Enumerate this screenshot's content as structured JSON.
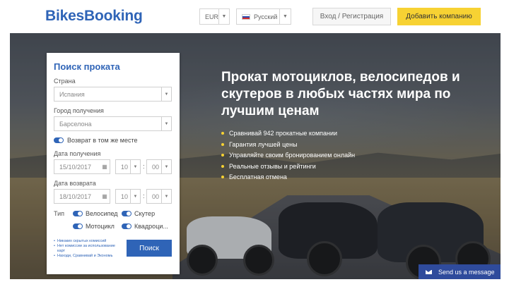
{
  "header": {
    "logo": "BikesBooking",
    "currency": "EUR",
    "language": "Русский",
    "login_label": "Вход / Регистрация",
    "add_company_label": "Добавить компанию"
  },
  "hero": {
    "headline": "Прокат мотоциклов, велосипедов и скутеров в любых частях мира по лучшим ценам",
    "bullets": [
      "Сравнивай 942 прокатные компании",
      "Гарантия лучшей цены",
      "Управляйте своим бронированием онлайн",
      "Реальные отзывы и рейтинги",
      "Бесплатная отмена"
    ]
  },
  "search": {
    "title": "Поиск проката",
    "country_label": "Страна",
    "country_value": "Испания",
    "city_label": "Город получения",
    "city_value": "Барселона",
    "same_place_label": "Возврат в том же месте",
    "pickup_label": "Дата получения",
    "pickup_date": "15/10/2017",
    "pickup_hour": "10",
    "pickup_min": "00",
    "return_label": "Дата возврата",
    "return_date": "18/10/2017",
    "return_hour": "10",
    "return_min": "00",
    "type_label": "Тип",
    "types": [
      "Велосипед",
      "Скутер",
      "Мотоцикл",
      "Квадроци..."
    ],
    "notes": [
      "Никаких скрытых комиссий",
      "Нет комиссии за использование карт",
      "Находи, Сравнивай и Экономь"
    ],
    "search_button": "Поиск"
  },
  "chat": {
    "label": "Send us a message"
  },
  "icons": {
    "dropdown": "chevron-down-icon",
    "calendar": "calendar-icon",
    "chat": "envelope-icon",
    "flag": "russia-flag-icon"
  },
  "colors": {
    "brand_blue": "#2f64b7",
    "accent_yellow": "#f7d233",
    "chat_blue": "#2f4b9c"
  }
}
